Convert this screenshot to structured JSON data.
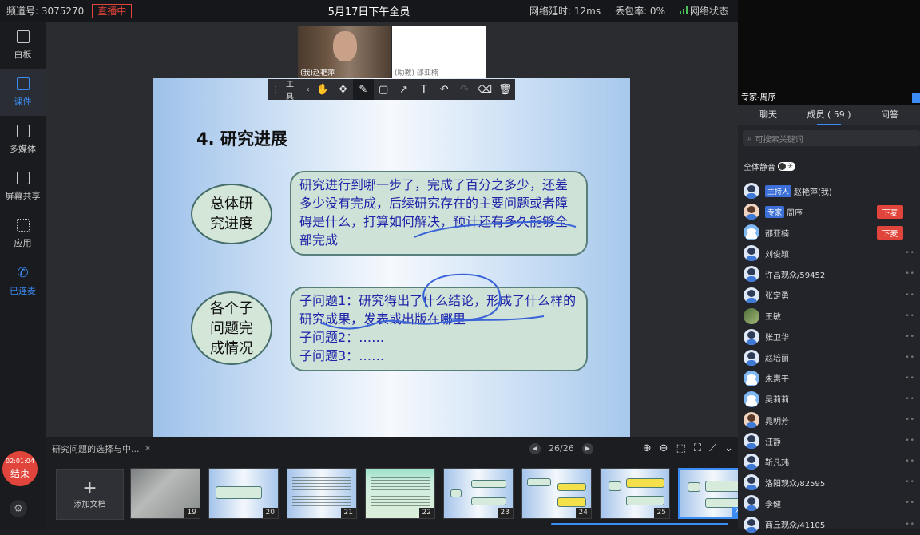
{
  "topbar": {
    "channel": "频道号: 3075270",
    "live_badge": "直播中",
    "title": "5月17日下午全员",
    "latency": "网络延时: 12ms",
    "packet_loss": "丢包率: 0%",
    "network_status": "网络状态"
  },
  "left_nav": {
    "items": [
      {
        "label": "白板",
        "icon": "whiteboard-icon"
      },
      {
        "label": "课件",
        "icon": "courseware-icon"
      },
      {
        "label": "多媒体",
        "icon": "media-play-icon"
      },
      {
        "label": "屏幕共享",
        "icon": "screen-share-icon"
      },
      {
        "label": "应用",
        "icon": "apps-grid-icon"
      },
      {
        "label": "已连麦",
        "icon": "phone-icon"
      }
    ],
    "timer": "02:01:04",
    "end_label": "结束"
  },
  "videos": [
    {
      "caption": "(我)赵艳萍"
    },
    {
      "caption": "(助教) 邵亚楠"
    }
  ],
  "toolbar": {
    "label": "工具",
    "tools": [
      "drag-hand-icon",
      "laser-pointer-icon",
      "pen-icon",
      "rectangle-icon",
      "arrow-icon",
      "text-icon",
      "undo-icon",
      "redo-icon",
      "eraser-icon",
      "trash-icon"
    ]
  },
  "slide": {
    "heading": "4. 研究进展",
    "ellipse1": "总体研究进度",
    "box1": "研究进行到哪一步了，完成了百分之多少，还差多少没有完成，后续研究存在的主要问题或者障碍是什么，打算如何解决，预计还有多久能够全部完成",
    "ellipse2": "各个子问题完成情况",
    "box2_line1": "子问题1：研究得出了什么结论，形成了什么样的研究成果，发表或出版在哪里",
    "box2_line2": "子问题2：……",
    "box2_line3": "子问题3：……"
  },
  "filmstrip": {
    "doc_title": "研究问题的选择与中...",
    "page": "26/26",
    "add_doc": "添加文档",
    "thumbs": [
      "19",
      "20",
      "21",
      "22",
      "23",
      "24",
      "25",
      "26"
    ],
    "selected": "26"
  },
  "right_panel": {
    "expert_name": "专家-周序",
    "tabs": [
      "聊天",
      "成员 ( 59 )",
      "问答"
    ],
    "search_placeholder": "可搜索关键词",
    "mute_all": "全体静音",
    "mute_toggle": "关",
    "kick_label": "下麦",
    "members": [
      {
        "role": "主持人",
        "name": "赵艳萍(我)"
      },
      {
        "role": "专家",
        "name": "周序"
      },
      {
        "role": "",
        "name": "邵亚楠"
      },
      {
        "role": "",
        "name": "刘俊颖"
      },
      {
        "role": "",
        "name": "许昌观众/59452"
      },
      {
        "role": "",
        "name": "张定勇"
      },
      {
        "role": "",
        "name": "王敏"
      },
      {
        "role": "",
        "name": "张卫华"
      },
      {
        "role": "",
        "name": "赵培丽"
      },
      {
        "role": "",
        "name": "朱惠平"
      },
      {
        "role": "",
        "name": "吴莉莉"
      },
      {
        "role": "",
        "name": "晁明芳"
      },
      {
        "role": "",
        "name": "汪静"
      },
      {
        "role": "",
        "name": "靳凡玮"
      },
      {
        "role": "",
        "name": "洛阳观众/82595"
      },
      {
        "role": "",
        "name": "李健"
      },
      {
        "role": "",
        "name": "商丘观众/41105"
      }
    ]
  },
  "colors": {
    "accent": "#3c8cf5",
    "danger": "#e0443a",
    "slide_text": "#1f24a8"
  }
}
